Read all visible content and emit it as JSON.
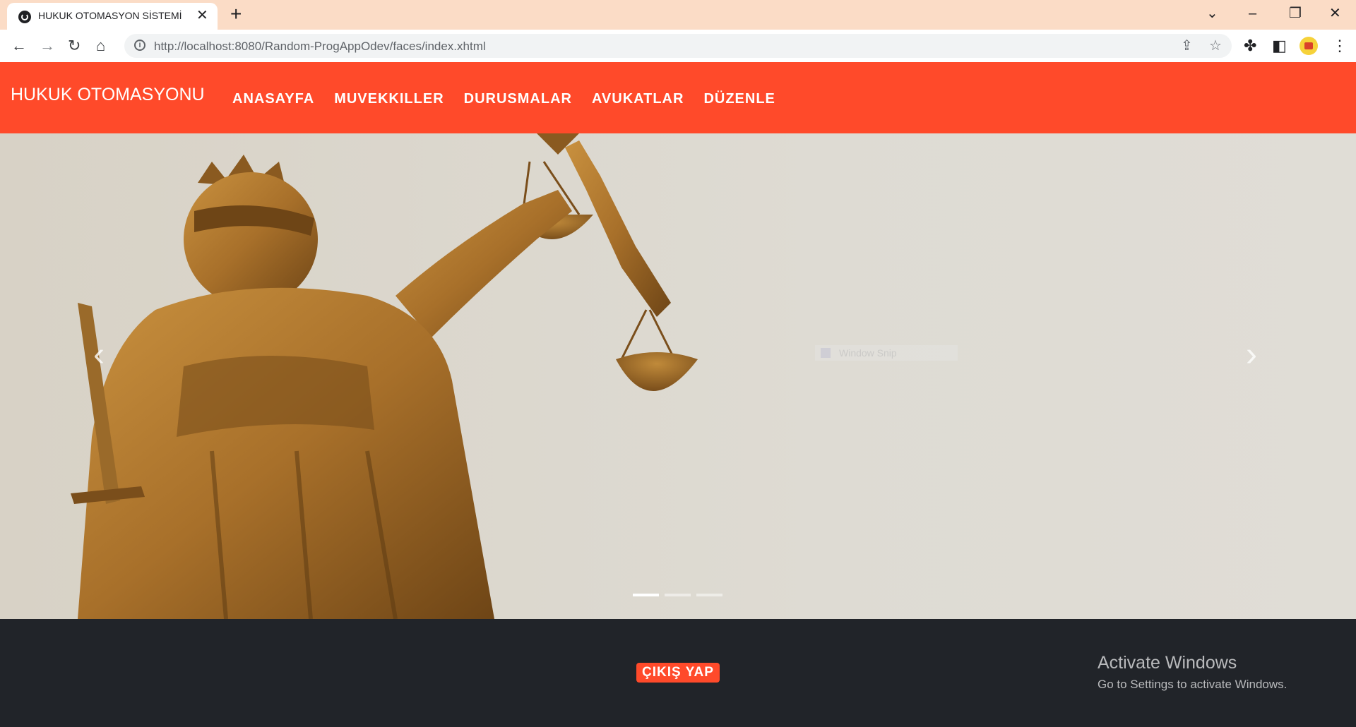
{
  "browser": {
    "tab_title": "HUKUK OTOMASYON SİSTEMİ",
    "tab_close": "✕",
    "new_tab": "+",
    "window_controls": {
      "dropdown": "⌄",
      "minimize": "–",
      "restore": "❐",
      "close": "✕"
    },
    "nav": {
      "back": "←",
      "forward": "→",
      "reload": "↻",
      "home": "⌂"
    },
    "url": "http://localhost:8080/Random-ProgAppOdev/faces/index.xhtml",
    "info_icon": "i",
    "share_icon": "⇪",
    "star_icon": "☆",
    "extensions_icon": "✤",
    "sidepanel_icon": "◧",
    "menu_icon": "⋮"
  },
  "navbar": {
    "brand": "HUKUK OTOMASYONU",
    "links": [
      "ANASAYFA",
      "MUVEKKILLER",
      "DURUSMALAR",
      "AVUKATLAR",
      "DÜZENLE"
    ]
  },
  "carousel": {
    "prev": "‹",
    "next": "›",
    "active_index": 0,
    "slide_count": 3,
    "overlay_text": "Window Snip"
  },
  "footer": {
    "logout_label": "ÇIKIŞ YAP"
  },
  "watermark": {
    "title": "Activate Windows",
    "subtitle": "Go to Settings to activate Windows."
  },
  "colors": {
    "accent": "#ff4a2a",
    "footer_bg": "#212429",
    "tabbar_bg": "#fbdcc6"
  }
}
